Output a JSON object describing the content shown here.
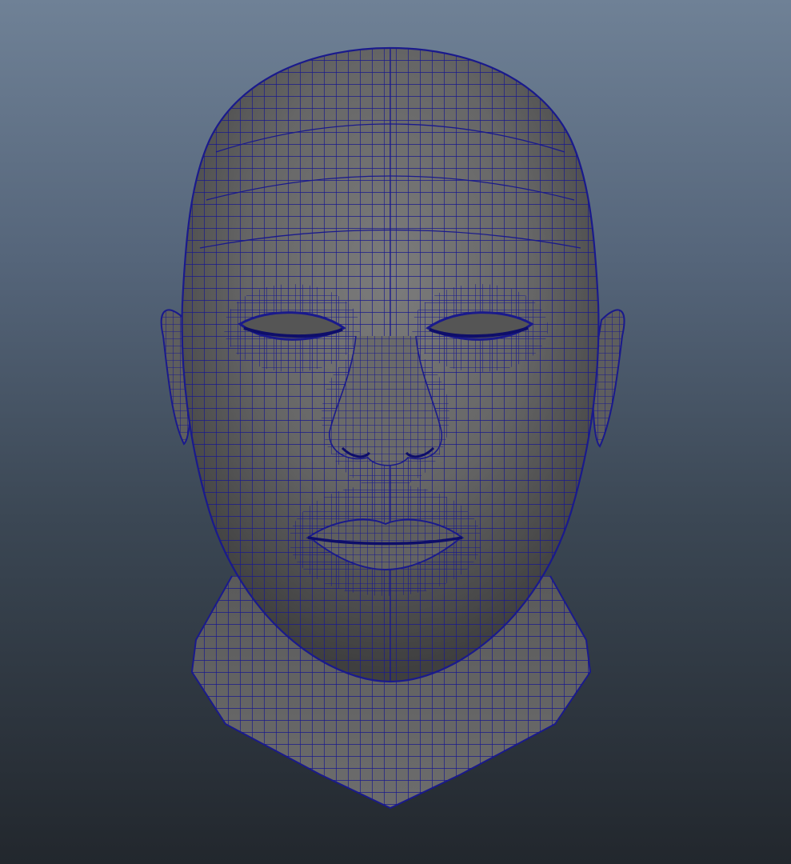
{
  "viewport": {
    "gradient_top": "#6f8196",
    "gradient_bottom": "#22272d"
  },
  "model": {
    "object": "head-mesh",
    "display_mode": "wireframe-on-shaded",
    "surface_color": "#6a6a6a",
    "wire_color": "#1a1a8c",
    "eyes": "closed"
  }
}
